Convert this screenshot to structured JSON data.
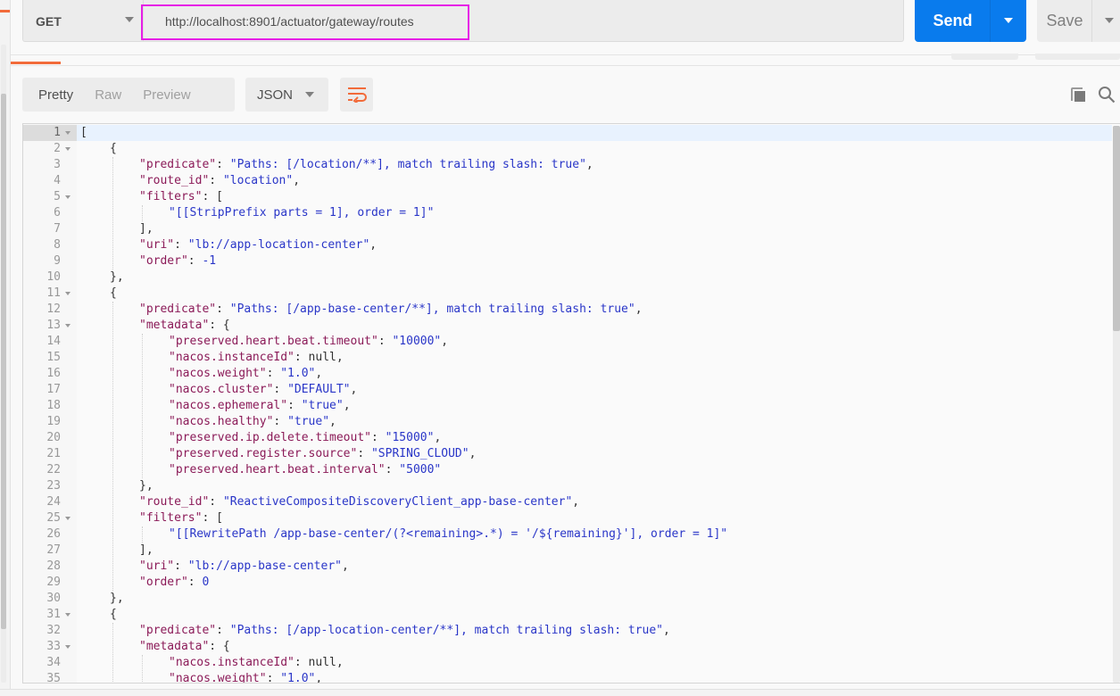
{
  "request": {
    "method": "GET",
    "url": "http://localhost:8901/actuator/gateway/routes",
    "send_label": "Send",
    "save_label": "Save"
  },
  "response_toolbar": {
    "view_tabs": [
      {
        "label": "Pretty",
        "active": true
      },
      {
        "label": "Raw",
        "active": false
      },
      {
        "label": "Preview",
        "active": false
      }
    ],
    "format": "JSON",
    "icons": [
      "wrap-lines-icon",
      "copy-icon",
      "search-icon"
    ]
  },
  "colors": {
    "accent": "#f26b3a",
    "send": "#097bed",
    "highlight_box": "#e61ee6",
    "json_key": "#8b1a58",
    "json_string": "#2a36c8"
  },
  "editor": {
    "lines": [
      {
        "n": "1",
        "fold": true,
        "indent": 0,
        "tokens": [
          [
            "p",
            "["
          ]
        ]
      },
      {
        "n": "2",
        "fold": true,
        "indent": 1,
        "tokens": [
          [
            "p",
            "{"
          ]
        ]
      },
      {
        "n": "3",
        "fold": false,
        "indent": 2,
        "tokens": [
          [
            "k",
            "\"predicate\""
          ],
          [
            "p",
            ": "
          ],
          [
            "s",
            "\"Paths: [/location/**], match trailing slash: true\""
          ],
          [
            "p",
            ","
          ]
        ]
      },
      {
        "n": "4",
        "fold": false,
        "indent": 2,
        "tokens": [
          [
            "k",
            "\"route_id\""
          ],
          [
            "p",
            ": "
          ],
          [
            "s",
            "\"location\""
          ],
          [
            "p",
            ","
          ]
        ]
      },
      {
        "n": "5",
        "fold": true,
        "indent": 2,
        "tokens": [
          [
            "k",
            "\"filters\""
          ],
          [
            "p",
            ": ["
          ]
        ]
      },
      {
        "n": "6",
        "fold": false,
        "indent": 3,
        "tokens": [
          [
            "s",
            "\"[[StripPrefix parts = 1], order = 1]\""
          ]
        ]
      },
      {
        "n": "7",
        "fold": false,
        "indent": 2,
        "tokens": [
          [
            "p",
            "],"
          ]
        ]
      },
      {
        "n": "8",
        "fold": false,
        "indent": 2,
        "tokens": [
          [
            "k",
            "\"uri\""
          ],
          [
            "p",
            ": "
          ],
          [
            "s",
            "\"lb://app-location-center\""
          ],
          [
            "p",
            ","
          ]
        ]
      },
      {
        "n": "9",
        "fold": false,
        "indent": 2,
        "tokens": [
          [
            "k",
            "\"order\""
          ],
          [
            "p",
            ": "
          ],
          [
            "n",
            "-1"
          ]
        ]
      },
      {
        "n": "10",
        "fold": false,
        "indent": 1,
        "tokens": [
          [
            "p",
            "},"
          ]
        ]
      },
      {
        "n": "11",
        "fold": true,
        "indent": 1,
        "tokens": [
          [
            "p",
            "{"
          ]
        ]
      },
      {
        "n": "12",
        "fold": false,
        "indent": 2,
        "tokens": [
          [
            "k",
            "\"predicate\""
          ],
          [
            "p",
            ": "
          ],
          [
            "s",
            "\"Paths: [/app-base-center/**], match trailing slash: true\""
          ],
          [
            "p",
            ","
          ]
        ]
      },
      {
        "n": "13",
        "fold": true,
        "indent": 2,
        "tokens": [
          [
            "k",
            "\"metadata\""
          ],
          [
            "p",
            ": {"
          ]
        ]
      },
      {
        "n": "14",
        "fold": false,
        "indent": 3,
        "tokens": [
          [
            "k",
            "\"preserved.heart.beat.timeout\""
          ],
          [
            "p",
            ": "
          ],
          [
            "s",
            "\"10000\""
          ],
          [
            "p",
            ","
          ]
        ]
      },
      {
        "n": "15",
        "fold": false,
        "indent": 3,
        "tokens": [
          [
            "k",
            "\"nacos.instanceId\""
          ],
          [
            "p",
            ": null,"
          ]
        ]
      },
      {
        "n": "16",
        "fold": false,
        "indent": 3,
        "tokens": [
          [
            "k",
            "\"nacos.weight\""
          ],
          [
            "p",
            ": "
          ],
          [
            "s",
            "\"1.0\""
          ],
          [
            "p",
            ","
          ]
        ]
      },
      {
        "n": "17",
        "fold": false,
        "indent": 3,
        "tokens": [
          [
            "k",
            "\"nacos.cluster\""
          ],
          [
            "p",
            ": "
          ],
          [
            "s",
            "\"DEFAULT\""
          ],
          [
            "p",
            ","
          ]
        ]
      },
      {
        "n": "18",
        "fold": false,
        "indent": 3,
        "tokens": [
          [
            "k",
            "\"nacos.ephemeral\""
          ],
          [
            "p",
            ": "
          ],
          [
            "s",
            "\"true\""
          ],
          [
            "p",
            ","
          ]
        ]
      },
      {
        "n": "19",
        "fold": false,
        "indent": 3,
        "tokens": [
          [
            "k",
            "\"nacos.healthy\""
          ],
          [
            "p",
            ": "
          ],
          [
            "s",
            "\"true\""
          ],
          [
            "p",
            ","
          ]
        ]
      },
      {
        "n": "20",
        "fold": false,
        "indent": 3,
        "tokens": [
          [
            "k",
            "\"preserved.ip.delete.timeout\""
          ],
          [
            "p",
            ": "
          ],
          [
            "s",
            "\"15000\""
          ],
          [
            "p",
            ","
          ]
        ]
      },
      {
        "n": "21",
        "fold": false,
        "indent": 3,
        "tokens": [
          [
            "k",
            "\"preserved.register.source\""
          ],
          [
            "p",
            ": "
          ],
          [
            "s",
            "\"SPRING_CLOUD\""
          ],
          [
            "p",
            ","
          ]
        ]
      },
      {
        "n": "22",
        "fold": false,
        "indent": 3,
        "tokens": [
          [
            "k",
            "\"preserved.heart.beat.interval\""
          ],
          [
            "p",
            ": "
          ],
          [
            "s",
            "\"5000\""
          ]
        ]
      },
      {
        "n": "23",
        "fold": false,
        "indent": 2,
        "tokens": [
          [
            "p",
            "},"
          ]
        ]
      },
      {
        "n": "24",
        "fold": false,
        "indent": 2,
        "tokens": [
          [
            "k",
            "\"route_id\""
          ],
          [
            "p",
            ": "
          ],
          [
            "s",
            "\"ReactiveCompositeDiscoveryClient_app-base-center\""
          ],
          [
            "p",
            ","
          ]
        ]
      },
      {
        "n": "25",
        "fold": true,
        "indent": 2,
        "tokens": [
          [
            "k",
            "\"filters\""
          ],
          [
            "p",
            ": ["
          ]
        ]
      },
      {
        "n": "26",
        "fold": false,
        "indent": 3,
        "tokens": [
          [
            "s",
            "\"[[RewritePath /app-base-center/(?<remaining>.*) = '/${remaining}'], order = 1]\""
          ]
        ]
      },
      {
        "n": "27",
        "fold": false,
        "indent": 2,
        "tokens": [
          [
            "p",
            "],"
          ]
        ]
      },
      {
        "n": "28",
        "fold": false,
        "indent": 2,
        "tokens": [
          [
            "k",
            "\"uri\""
          ],
          [
            "p",
            ": "
          ],
          [
            "s",
            "\"lb://app-base-center\""
          ],
          [
            "p",
            ","
          ]
        ]
      },
      {
        "n": "29",
        "fold": false,
        "indent": 2,
        "tokens": [
          [
            "k",
            "\"order\""
          ],
          [
            "p",
            ": "
          ],
          [
            "n",
            "0"
          ]
        ]
      },
      {
        "n": "30",
        "fold": false,
        "indent": 1,
        "tokens": [
          [
            "p",
            "},"
          ]
        ]
      },
      {
        "n": "31",
        "fold": true,
        "indent": 1,
        "tokens": [
          [
            "p",
            "{"
          ]
        ]
      },
      {
        "n": "32",
        "fold": false,
        "indent": 2,
        "tokens": [
          [
            "k",
            "\"predicate\""
          ],
          [
            "p",
            ": "
          ],
          [
            "s",
            "\"Paths: [/app-location-center/**], match trailing slash: true\""
          ],
          [
            "p",
            ","
          ]
        ]
      },
      {
        "n": "33",
        "fold": true,
        "indent": 2,
        "tokens": [
          [
            "k",
            "\"metadata\""
          ],
          [
            "p",
            ": {"
          ]
        ]
      },
      {
        "n": "34",
        "fold": false,
        "indent": 3,
        "tokens": [
          [
            "k",
            "\"nacos.instanceId\""
          ],
          [
            "p",
            ": null,"
          ]
        ]
      },
      {
        "n": "35",
        "fold": false,
        "indent": 3,
        "tokens": [
          [
            "k",
            "\"nacos.weight\""
          ],
          [
            "p",
            ": "
          ],
          [
            "s",
            "\"1.0\""
          ],
          [
            "p",
            ","
          ]
        ]
      }
    ]
  }
}
